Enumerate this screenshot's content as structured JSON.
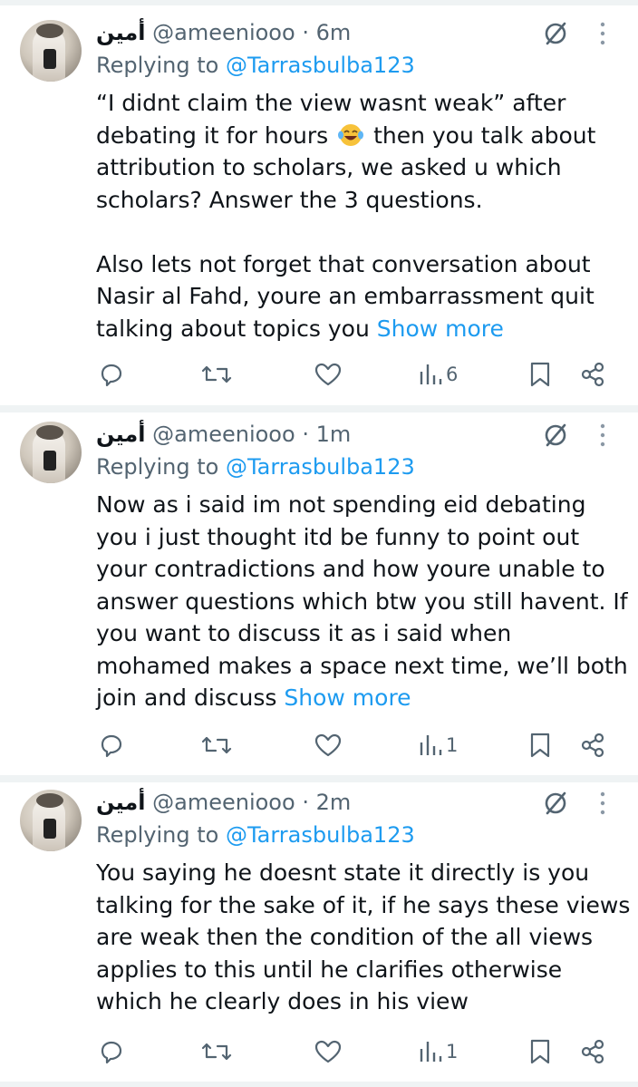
{
  "tweets": [
    {
      "display_name": "أمين",
      "handle": "@ameeniooo",
      "time": "· 6m",
      "replying_label": "Replying to",
      "replying_to": "@Tarrasbulba123",
      "para1_a": "“I didnt claim the view wasnt weak” after debating it for hours",
      "emoji": "😂",
      "para1_b": "then you talk about attribution to scholars, we asked u which scholars? Answer the 3 questions.",
      "para2": "Also lets not forget that conversation about Nasir al Fahd, youre an embarrassment quit talking about topics you",
      "show_more": "Show more",
      "views": "6"
    },
    {
      "display_name": "أمين",
      "handle": "@ameeniooo",
      "time": "· 1m",
      "replying_label": "Replying to",
      "replying_to": "@Tarrasbulba123",
      "para1": "Now as i said im not spending eid debating you i just thought itd be funny to point out your contradictions and how youre unable to answer questions which btw you still havent. If you want to discuss it as i said when mohamed makes a space next time, we’ll both join and discuss",
      "show_more": "Show more",
      "views": "1"
    },
    {
      "display_name": "أمين",
      "handle": "@ameeniooo",
      "time": "· 2m",
      "replying_label": "Replying to",
      "replying_to": "@Tarrasbulba123",
      "para1": "You saying he doesnt state it directly is you talking for the sake of it, if he says these views are weak then the condition of the all views applies to this until he clarifies otherwise which he clearly does in his view",
      "views": "1"
    }
  ],
  "colors": {
    "text": "#0f1419",
    "secondary": "#536471",
    "accent": "#1d9bf0",
    "divider": "#eff3f4"
  },
  "icons": [
    "grok-icon",
    "more-icon",
    "reply-icon",
    "retweet-icon",
    "like-icon",
    "views-icon",
    "bookmark-icon",
    "share-icon"
  ]
}
